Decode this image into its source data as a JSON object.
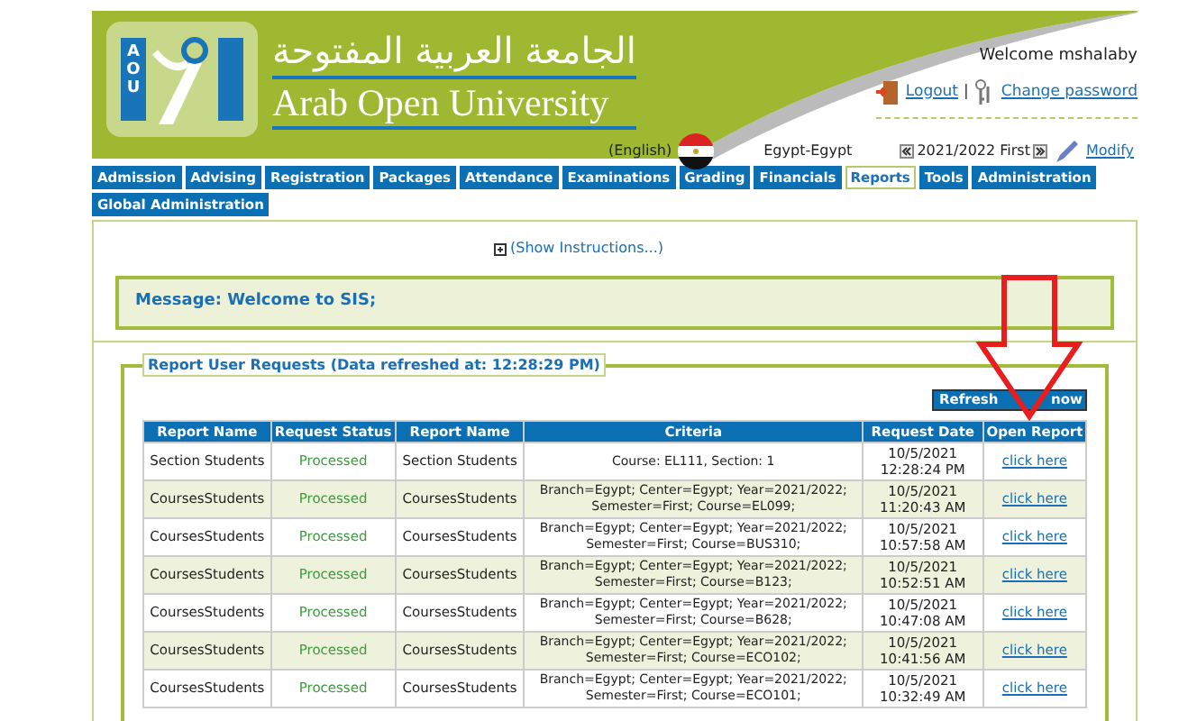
{
  "header": {
    "title_ar": "الجامعة العربية المفتوحة",
    "title_en": "Arab Open University",
    "logo_letters": "AOU",
    "welcome": "Welcome mshalaby",
    "logout": "Logout",
    "separator": "|",
    "change_password": "Change password"
  },
  "locale": {
    "language": "(English)",
    "branch": "Egypt-Egypt",
    "term": "2021/2022 First",
    "modify": "Modify"
  },
  "tabs": [
    {
      "label": "Admission",
      "selected": false
    },
    {
      "label": "Advising",
      "selected": false
    },
    {
      "label": "Registration",
      "selected": false
    },
    {
      "label": "Packages",
      "selected": false
    },
    {
      "label": "Attendance",
      "selected": false
    },
    {
      "label": "Examinations",
      "selected": false
    },
    {
      "label": "Grading",
      "selected": false
    },
    {
      "label": "Financials",
      "selected": false
    },
    {
      "label": "Reports",
      "selected": true
    },
    {
      "label": "Tools",
      "selected": false
    },
    {
      "label": "Administration",
      "selected": false
    },
    {
      "label": "Global Administration",
      "selected": false
    }
  ],
  "instructions": "(Show Instructions...)",
  "message": "Message: Welcome to SIS;",
  "requests": {
    "legend": "Report User Requests (Data refreshed at: 12:28:29 PM)",
    "refresh": [
      "Refresh",
      "now"
    ],
    "columns": [
      "Report Name",
      "Request Status",
      "Report Name",
      "Criteria",
      "Request Date",
      "Open Report"
    ],
    "rows": [
      {
        "report": "Section Students",
        "status": "Processed",
        "report_2": "Section Students",
        "criteria": [
          "Course: EL111, Section: 1"
        ],
        "date": "10/5/2021",
        "time": "12:28:24 PM",
        "link": "click here"
      },
      {
        "report": "CoursesStudents",
        "status": "Processed",
        "report_2": "CoursesStudents",
        "criteria": [
          "Branch=Egypt; Center=Egypt; Year=2021/2022;",
          "Semester=First; Course=EL099;"
        ],
        "date": "10/5/2021",
        "time": "11:20:43 AM",
        "link": "click here"
      },
      {
        "report": "CoursesStudents",
        "status": "Processed",
        "report_2": "CoursesStudents",
        "criteria": [
          "Branch=Egypt; Center=Egypt; Year=2021/2022;",
          "Semester=First; Course=BUS310;"
        ],
        "date": "10/5/2021",
        "time": "10:57:58 AM",
        "link": "click here"
      },
      {
        "report": "CoursesStudents",
        "status": "Processed",
        "report_2": "CoursesStudents",
        "criteria": [
          "Branch=Egypt; Center=Egypt; Year=2021/2022;",
          "Semester=First; Course=B123;"
        ],
        "date": "10/5/2021",
        "time": "10:52:51 AM",
        "link": "click here"
      },
      {
        "report": "CoursesStudents",
        "status": "Processed",
        "report_2": "CoursesStudents",
        "criteria": [
          "Branch=Egypt; Center=Egypt; Year=2021/2022;",
          "Semester=First; Course=B628;"
        ],
        "date": "10/5/2021",
        "time": "10:47:08 AM",
        "link": "click here"
      },
      {
        "report": "CoursesStudents",
        "status": "Processed",
        "report_2": "CoursesStudents",
        "criteria": [
          "Branch=Egypt; Center=Egypt; Year=2021/2022;",
          "Semester=First; Course=ECO102;"
        ],
        "date": "10/5/2021",
        "time": "10:41:56 AM",
        "link": "click here"
      },
      {
        "report": "CoursesStudents",
        "status": "Processed",
        "report_2": "CoursesStudents",
        "criteria": [
          "Branch=Egypt; Center=Egypt; Year=2021/2022;",
          "Semester=First; Course=ECO101;"
        ],
        "date": "10/5/2021",
        "time": "10:32:49 AM",
        "link": "click here"
      }
    ]
  }
}
